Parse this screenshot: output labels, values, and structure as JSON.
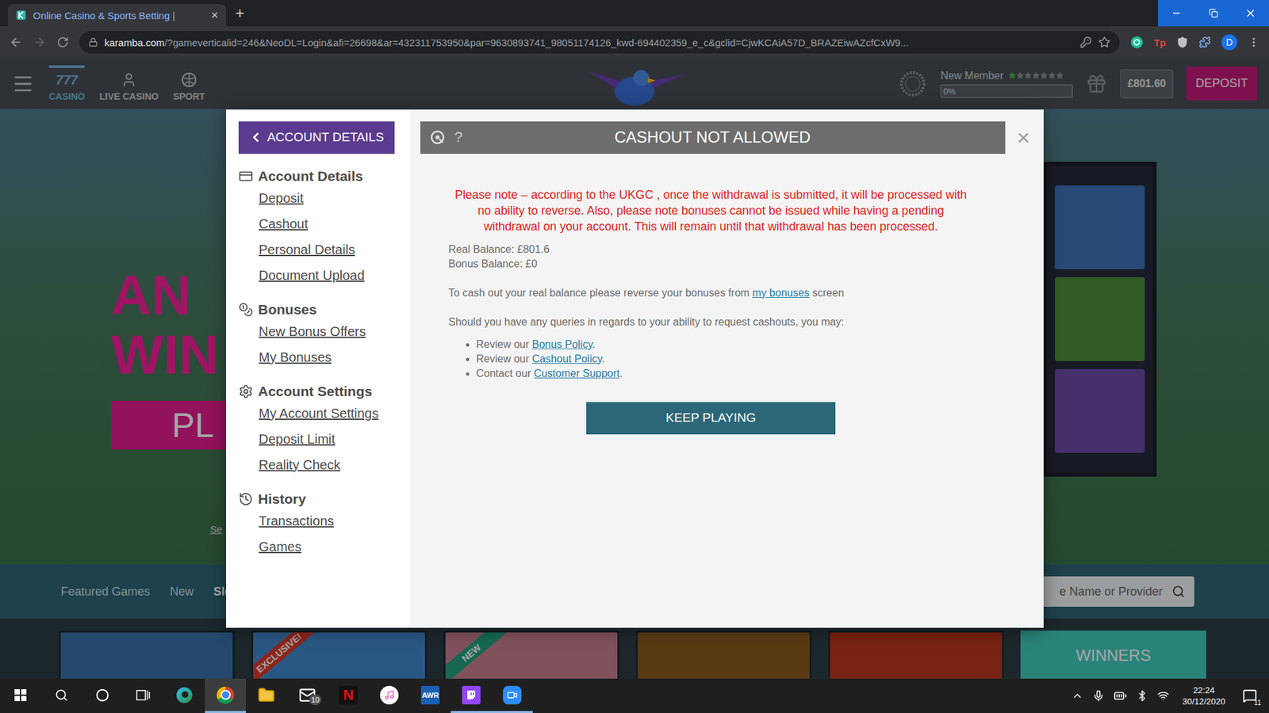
{
  "browser": {
    "tab": {
      "title": "Online Casino & Sports Betting |",
      "close": "×",
      "selected": true
    },
    "new_tab": "+",
    "url": {
      "host": "karamba.com",
      "path": "/?gameverticalid=246&NeoDL=Login&afi=26698&ar=432311753950&par=9630893741_98051174126_kwd-694402359_e_c&gclid=CjwKCAiA57D_BRAZEiwAZcfCxW9..."
    },
    "extension_label": "Tp",
    "profile": "D"
  },
  "site": {
    "nav": [
      {
        "label": "CASINO",
        "glyph": "777",
        "selected": true
      },
      {
        "label": "LIVE CASINO",
        "glyph": "",
        "selected": false
      },
      {
        "label": "SPORT",
        "glyph": "",
        "selected": false
      }
    ],
    "member": {
      "label": "New Member",
      "stars": 1,
      "star_count": 7,
      "level": 0,
      "reading": "0%"
    },
    "balance": "£801.60",
    "deposit": "DEPOSIT",
    "hero": {
      "lines": [
        "AN",
        "WIN"
      ],
      "button": "PL",
      "link": "Se"
    },
    "categories": [
      {
        "label": "Featured Games",
        "selected": false
      },
      {
        "label": "New",
        "selected": false
      },
      {
        "label": "Slots",
        "selected": true
      }
    ],
    "search": {
      "placeholder": "e Name or Provider"
    },
    "games": [
      {
        "badge": "",
        "badge_color": "",
        "color": "#3a6fa8"
      },
      {
        "badge": "EXCLUSIVE!",
        "badge_color": "#d93a2b",
        "color": "#3f86c9"
      },
      {
        "badge": "NEW",
        "badge_color": "#24a07f",
        "color": "#c77f8e"
      },
      {
        "badge": "",
        "badge_color": "",
        "color": "#8a5a1e"
      },
      {
        "badge": "",
        "badge_color": "",
        "color": "#b8361e"
      }
    ],
    "winners": "WINNERS"
  },
  "modal": {
    "back": "ACCOUNT DETAILS",
    "sections": [
      {
        "title": "Account Details",
        "items": [
          "Deposit",
          "Cashout",
          "Personal Details",
          "Document Upload"
        ]
      },
      {
        "title": "Bonuses",
        "items": [
          "New Bonus Offers",
          "My Bonuses"
        ]
      },
      {
        "title": "Account Settings",
        "items": [
          "My Account Settings",
          "Deposit Limit",
          "Reality Check"
        ]
      },
      {
        "title": "History",
        "items": [
          "Transactions",
          "Games"
        ]
      }
    ],
    "title": "CASHOUT NOT ALLOWED",
    "help": "?",
    "close": "×",
    "warning": "Please note – according to the UKGC , once the withdrawal is submitted, it will be processed with no ability to reverse. Also, please note bonuses cannot be issued while having a pending withdrawal on your account. This will remain until that withdrawal has been processed.",
    "balances": [
      "Real Balance: £801.6",
      "Bonus Balance: £0"
    ],
    "instruction": {
      "before": "To cash out your real balance please reverse your bonuses from ",
      "link": "my bonuses",
      "after": " screen"
    },
    "queries_intro": "Should you have any queries in regards to your ability to request cashouts, you may:",
    "queries": [
      {
        "before": "Review our ",
        "link": "Bonus Policy",
        "after": "."
      },
      {
        "before": "Review our ",
        "link": "Cashout Policy",
        "after": "."
      },
      {
        "before": "Contact our ",
        "link": "Customer Support",
        "after": "."
      }
    ],
    "button": "KEEP PLAYING"
  },
  "taskbar": {
    "apps": [
      {
        "kind": "edge",
        "label": "",
        "badge": "",
        "active": false,
        "running": false
      },
      {
        "kind": "chrome",
        "label": "",
        "badge": "",
        "active": true,
        "running": true
      },
      {
        "kind": "files",
        "label": "",
        "badge": "",
        "active": false,
        "running": false
      },
      {
        "kind": "mail",
        "label": "",
        "badge": "10",
        "active": false,
        "running": false
      },
      {
        "kind": "netflix",
        "label": "N",
        "badge": "",
        "active": false,
        "running": false
      },
      {
        "kind": "itunes",
        "label": "",
        "badge": "",
        "active": false,
        "running": false
      },
      {
        "kind": "awr",
        "label": "AWR",
        "badge": "",
        "active": false,
        "running": false
      },
      {
        "kind": "twitch",
        "label": "",
        "badge": "",
        "active": false,
        "running": true
      },
      {
        "kind": "zoom",
        "label": "",
        "badge": "",
        "active": false,
        "running": true
      }
    ],
    "time": "22:24",
    "date": "30/12/2020",
    "notifications": "11"
  }
}
